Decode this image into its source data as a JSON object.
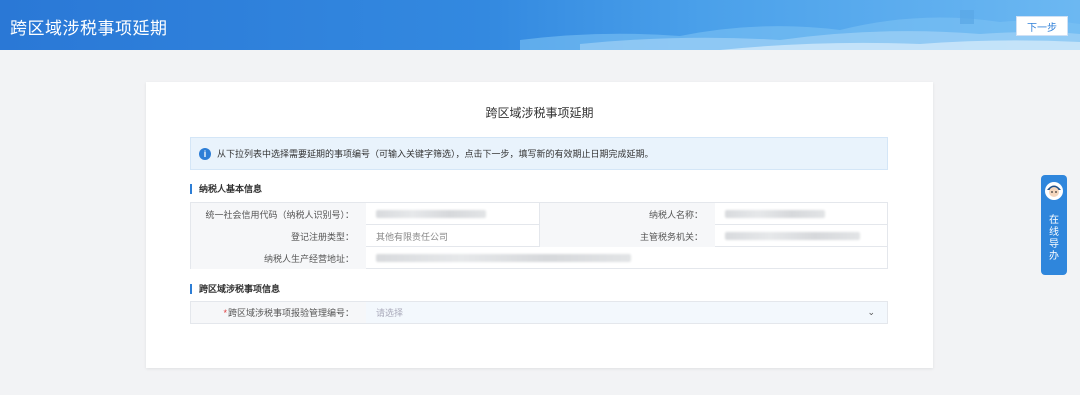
{
  "header": {
    "title": "跨区域涉税事项延期",
    "next_button": "下一步"
  },
  "card": {
    "title": "跨区域涉税事项延期",
    "notice": "从下拉列表中选择需要延期的事项编号（可输入关键字筛选），点击下一步，填写新的有效期止日期完成延期。"
  },
  "taxpayer_section": {
    "title": "纳税人基本信息",
    "fields": {
      "credit_code_label": "统一社会信用代码（纳税人识别号）：",
      "name_label": "纳税人名称：",
      "reg_type_label": "登记注册类型：",
      "reg_type_value": "其他有限责任公司",
      "tax_office_label": "主管税务机关：",
      "address_label": "纳税人生产经营地址："
    }
  },
  "cross_section": {
    "title": "跨区域涉税事项信息",
    "required_mark": "*",
    "number_label": "跨区域涉税事项报验管理编号：",
    "number_placeholder": "请选择"
  },
  "side_guide": {
    "text": "在线导办"
  },
  "colors": {
    "primary": "#2d7ed6",
    "notice_bg": "#e9f3fc",
    "required": "#e03c3c"
  }
}
